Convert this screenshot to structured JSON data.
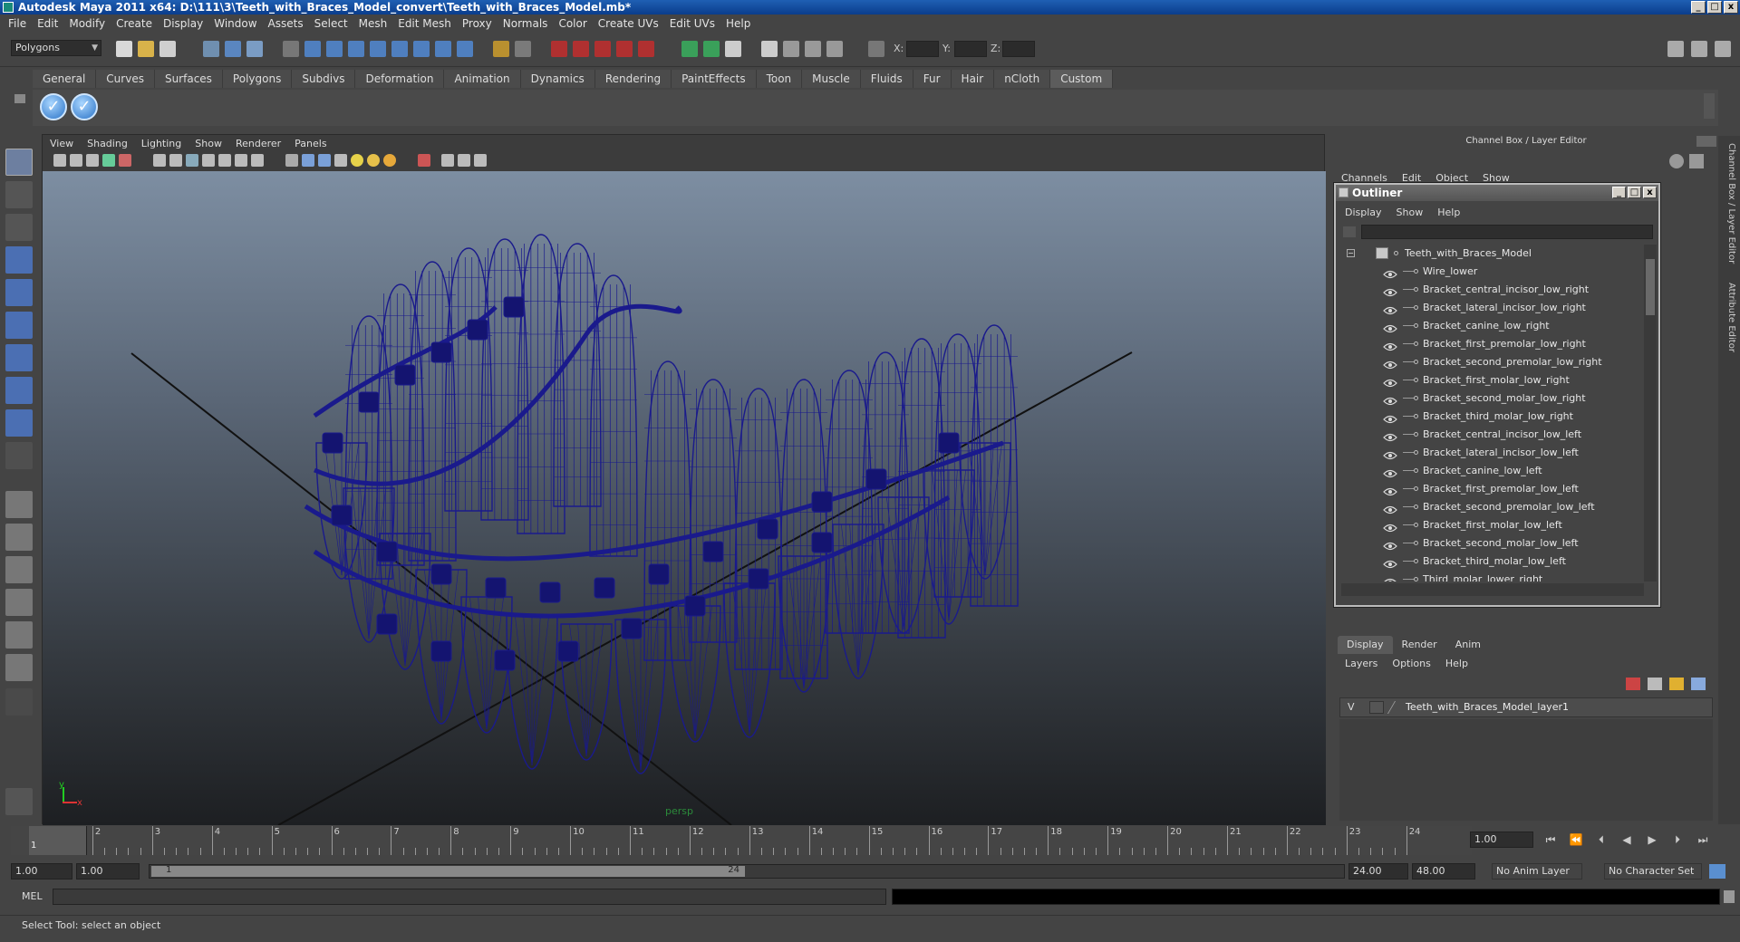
{
  "window": {
    "title": "Autodesk Maya 2011 x64: D:\\111\\3\\Teeth_with_Braces_Model_convert\\Teeth_with_Braces_Model.mb*",
    "min": "_",
    "max": "□",
    "close": "x"
  },
  "menubar": [
    "File",
    "Edit",
    "Modify",
    "Create",
    "Display",
    "Window",
    "Assets",
    "Select",
    "Mesh",
    "Edit Mesh",
    "Proxy",
    "Normals",
    "Color",
    "Create UVs",
    "Edit UVs",
    "Help"
  ],
  "statusline": {
    "mode": "Polygons",
    "x_label": "X:",
    "y_label": "Y:",
    "z_label": "Z:"
  },
  "shelf": {
    "tabs": [
      "General",
      "Curves",
      "Surfaces",
      "Polygons",
      "Subdivs",
      "Deformation",
      "Animation",
      "Dynamics",
      "Rendering",
      "PaintEffects",
      "Toon",
      "Muscle",
      "Fluids",
      "Fur",
      "Hair",
      "nCloth",
      "Custom"
    ],
    "active_tab": "Custom"
  },
  "viewport": {
    "menu": [
      "View",
      "Shading",
      "Lighting",
      "Show",
      "Renderer",
      "Panels"
    ],
    "camera": "persp",
    "wire_color": "#1a1a8c",
    "axis_y": "y",
    "axis_x": "x"
  },
  "right_panel": {
    "title": "Channel Box / Layer Editor",
    "menu": [
      "Channels",
      "Edit",
      "Object",
      "Show"
    ]
  },
  "outliner": {
    "title": "Outliner",
    "menu": [
      "Display",
      "Show",
      "Help"
    ],
    "root": "Teeth_with_Braces_Model",
    "items": [
      "Wire_lower",
      "Bracket_central_incisor_low_right",
      "Bracket_lateral_incisor_low_right",
      "Bracket_canine_low_right",
      "Bracket_first_premolar_low_right",
      "Bracket_second_premolar_low_right",
      "Bracket_first_molar_low_right",
      "Bracket_second_molar_low_right",
      "Bracket_third_molar_low_right",
      "Bracket_central_incisor_low_left",
      "Bracket_lateral_incisor_low_left",
      "Bracket_canine_low_left",
      "Bracket_first_premolar_low_left",
      "Bracket_second_premolar_low_left",
      "Bracket_first_molar_low_left",
      "Bracket_second_molar_low_left",
      "Bracket_third_molar_low_left",
      "Third_molar_lower_right"
    ]
  },
  "layer_editor": {
    "tabs": [
      "Display",
      "Render",
      "Anim"
    ],
    "active_tab": "Display",
    "menu": [
      "Layers",
      "Options",
      "Help"
    ],
    "layer": {
      "visible": "V",
      "name": "Teeth_with_Braces_Model_layer1"
    }
  },
  "timeline": {
    "ticks": [
      "1",
      "2",
      "3",
      "4",
      "5",
      "6",
      "7",
      "8",
      "9",
      "10",
      "11",
      "12",
      "13",
      "14",
      "15",
      "16",
      "17",
      "18",
      "19",
      "20",
      "21",
      "22",
      "23",
      "24"
    ],
    "current_marker": "1",
    "current_frame": "1.00"
  },
  "range": {
    "start": "1.00",
    "anim_start": "1.00",
    "range_start_label": "1",
    "range_end_label": "24",
    "end": "24.00",
    "anim_end": "48.00",
    "anim_layer": "No Anim Layer",
    "character_set": "No Character Set"
  },
  "cmdline": {
    "language": "MEL"
  },
  "helpline": {
    "text": "Select Tool: select an object"
  },
  "sidetabs": {
    "tab1": "Channel Box / Layer Editor",
    "tab2": "Attribute Editor"
  }
}
